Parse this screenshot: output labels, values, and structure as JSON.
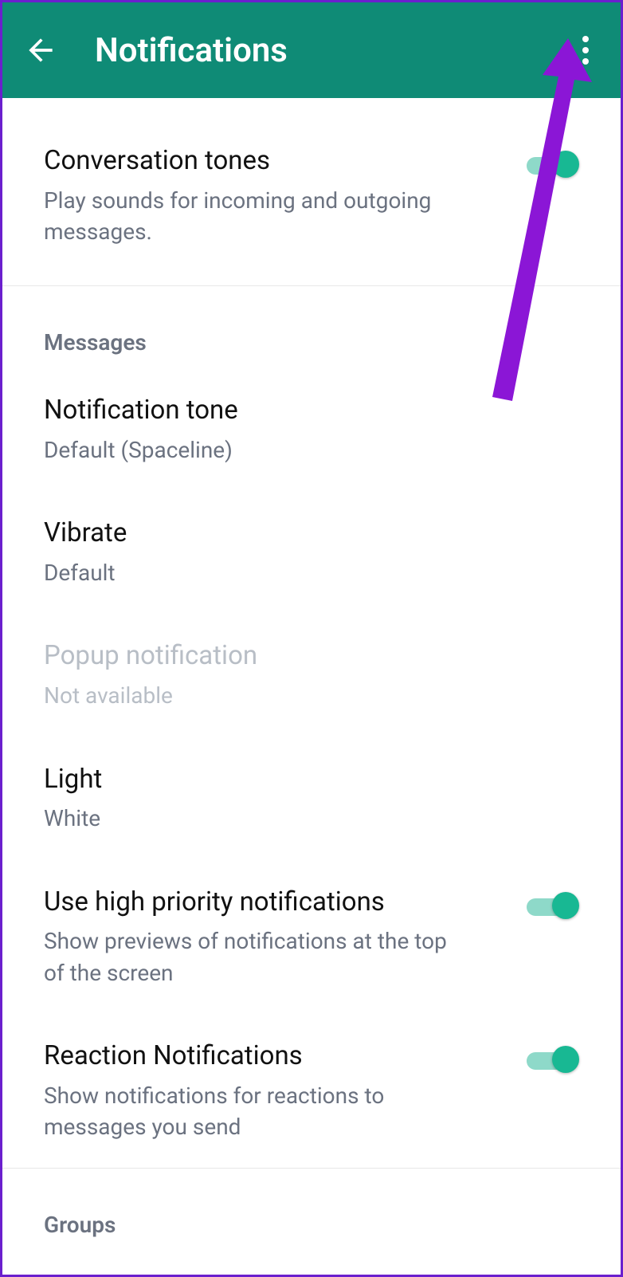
{
  "appbar": {
    "title": "Notifications"
  },
  "settings": {
    "conversationTones": {
      "title": "Conversation tones",
      "sub": "Play sounds for incoming and outgoing messages."
    },
    "sectionMessages": "Messages",
    "notificationTone": {
      "title": "Notification tone",
      "sub": "Default (Spaceline)"
    },
    "vibrate": {
      "title": "Vibrate",
      "sub": "Default"
    },
    "popup": {
      "title": "Popup notification",
      "sub": "Not available"
    },
    "light": {
      "title": "Light",
      "sub": "White"
    },
    "highPriority": {
      "title": "Use high priority notifications",
      "sub": "Show previews of notifications at the top of the screen"
    },
    "reaction": {
      "title": "Reaction Notifications",
      "sub": "Show notifications for reactions to messages you send"
    },
    "sectionGroups": "Groups"
  },
  "annotation": {
    "color": "#8b16d6"
  }
}
